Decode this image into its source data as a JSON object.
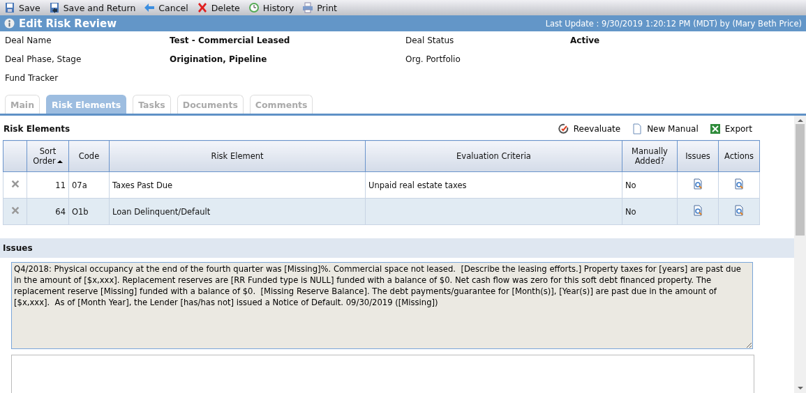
{
  "toolbar": [
    {
      "label": "Save",
      "kind": "save"
    },
    {
      "label": "Save and Return",
      "kind": "save-return"
    },
    {
      "label": "Cancel",
      "kind": "back"
    },
    {
      "label": "Delete",
      "kind": "delete"
    },
    {
      "label": "History",
      "kind": "history"
    },
    {
      "label": "Print",
      "kind": "print"
    }
  ],
  "header": {
    "title": "Edit Risk Review",
    "last_update": "Last Update : 9/30/2019 1:20:12 PM (MDT) by (Mary Beth Price)"
  },
  "info": [
    {
      "label": "Deal Name",
      "value": "Test - Commercial Leased"
    },
    {
      "label": "Deal Status",
      "value": "Active"
    },
    {
      "label": "Deal Phase, Stage",
      "value": "Origination, Pipeline"
    },
    {
      "label": "Org. Portfolio"
    },
    {
      "label": "Fund Tracker"
    }
  ],
  "tabs": [
    {
      "label": "Main",
      "selected": false
    },
    {
      "label": "Risk Elements",
      "selected": true
    },
    {
      "label": "Tasks",
      "selected": false
    },
    {
      "label": "Documents",
      "selected": false
    },
    {
      "label": "Comments",
      "selected": false
    }
  ],
  "section": {
    "title": "Risk Elements",
    "actions": [
      {
        "label": "Reevaluate",
        "kind": "reevaluate"
      },
      {
        "label": "New Manual",
        "kind": "page"
      },
      {
        "label": "Export",
        "kind": "excel"
      }
    ]
  },
  "table": {
    "columns": [
      {
        "label": "Sort Order",
        "sorted": true
      },
      {
        "label": "Code",
        "sorted": false
      },
      {
        "label": "Risk Element",
        "sorted": false
      },
      {
        "label": "Evaluation Criteria",
        "sorted": false
      },
      {
        "label": "Manually Added?",
        "sorted": false
      },
      {
        "label": "Issues",
        "sorted": false
      },
      {
        "label": "Actions",
        "sorted": false
      }
    ],
    "rows": [
      {
        "sort_order": "11",
        "code": "07a",
        "risk_element": "Taxes Past Due",
        "evaluation_criteria": "Unpaid real estate taxes",
        "manually_added": "No"
      },
      {
        "sort_order": "64",
        "code": "O1b",
        "risk_element": "Loan Delinquent/Default",
        "manually_added": "No"
      }
    ]
  },
  "issues": {
    "title": "Issues",
    "text": "Q4/2018: Physical occupancy at the end of the fourth quarter was [Missing]%. Commercial space not leased.  [Describe the leasing efforts.] Property taxes for [years] are past due in the amount of [$x,xxx]. Replacement reserves are [RR Funded type is NULL] funded with a balance of $0. Net cash flow was zero for this soft debt financed property. The replacement reserve [Missing] funded with a balance of $0.  [Missing Reserve Balance]. The debt payments/guarantee for [Month(s)], [Year(s)] are past due in the amount of [$x,xxx].  As of [Month Year], the Lender [has/has not] issued a Notice of Default. 09/30/2019 ([Missing])"
  }
}
